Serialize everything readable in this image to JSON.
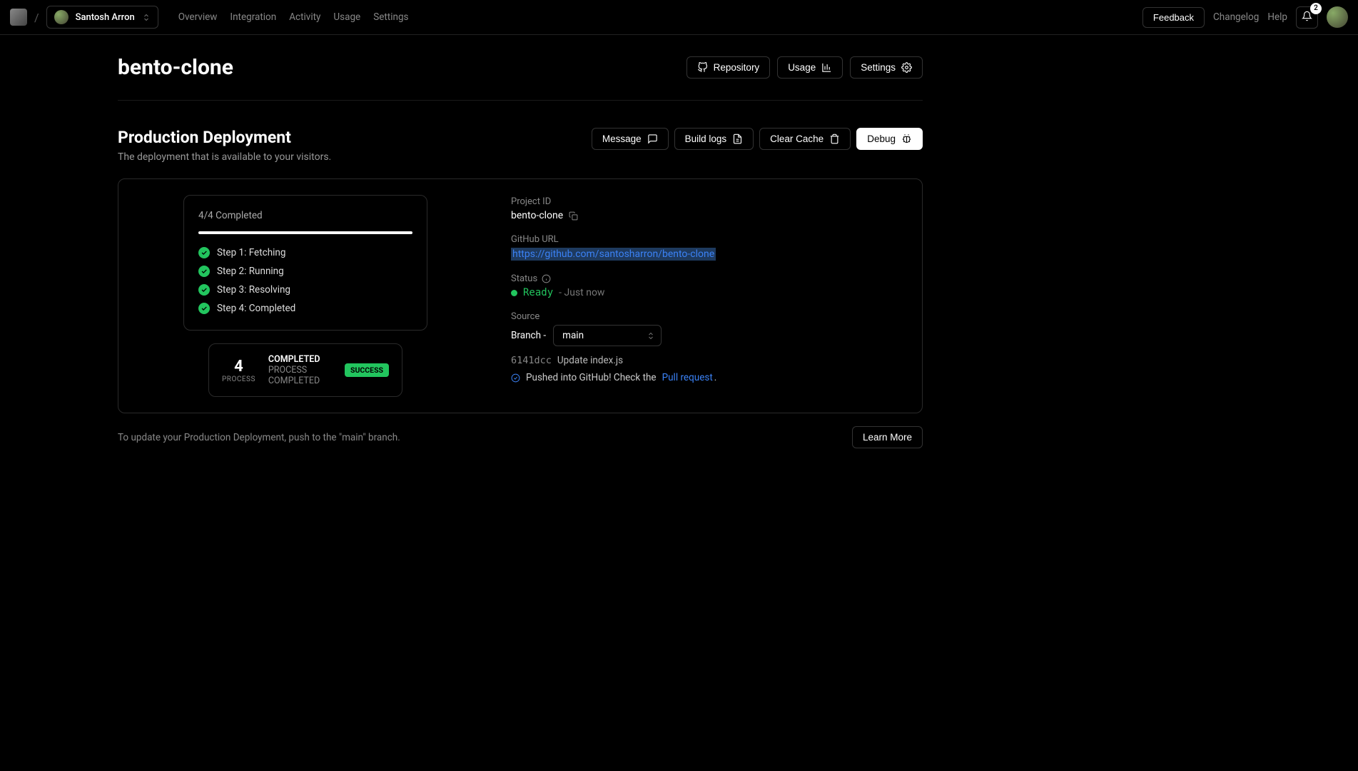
{
  "topbar": {
    "user_name": "Santosh Arron",
    "nav": [
      "Overview",
      "Integration",
      "Activity",
      "Usage",
      "Settings"
    ],
    "feedback": "Feedback",
    "changelog": "Changelog",
    "help": "Help",
    "notif_count": "2"
  },
  "header": {
    "title": "bento-clone",
    "repo_btn": "Repository",
    "usage_btn": "Usage",
    "settings_btn": "Settings"
  },
  "section": {
    "title": "Production Deployment",
    "subtitle": "The deployment that is available to your visitors.",
    "message_btn": "Message",
    "buildlogs_btn": "Build logs",
    "clearcache_btn": "Clear Cache",
    "debug_btn": "Debug"
  },
  "steps": {
    "progress": "4/4 Completed",
    "items": [
      "Step 1: Fetching",
      "Step 2: Running",
      "Step 3: Resolving",
      "Step 4: Completed"
    ]
  },
  "summary": {
    "num": "4",
    "numlabel": "PROCESS",
    "line1": "COMPLETED",
    "line2": "PROCESS COMPLETED",
    "pill": "SUCCESS"
  },
  "details": {
    "projectid_label": "Project ID",
    "projectid_value": "bento-clone",
    "github_label": "GitHub URL",
    "github_value": "https://github.com/santosharron/bento-clone",
    "status_label": "Status",
    "status_value": "Ready",
    "status_time": "- Just now",
    "source_label": "Source",
    "branch_label": "Branch -",
    "branch_value": "main",
    "commit_hash": "6141dcc",
    "commit_msg": "Update index.js",
    "push_text": "Pushed into GitHub! Check the",
    "pr_link": "Pull request",
    "push_suffix": "."
  },
  "footer": {
    "text": "To update your Production Deployment, push to the \"main\" branch.",
    "learn_more": "Learn More"
  }
}
